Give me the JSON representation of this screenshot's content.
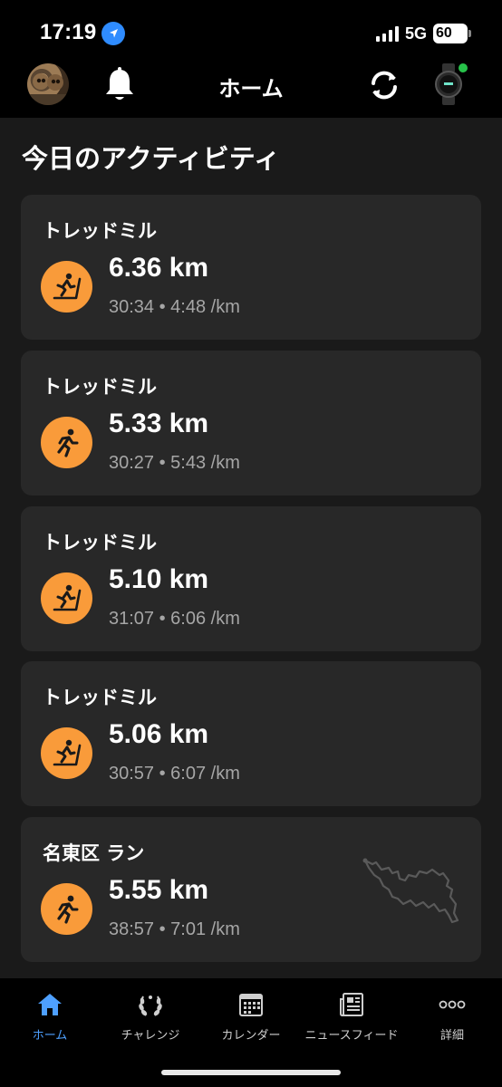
{
  "status_bar": {
    "time": "17:19",
    "network": "5G",
    "battery": "60"
  },
  "header": {
    "title": "ホーム"
  },
  "section": {
    "title": "今日のアクティビティ"
  },
  "activities": [
    {
      "title": "トレッドミル",
      "distance": "6.36 km",
      "meta": "30:34 • 4:48 /km",
      "icon": "treadmill-icon"
    },
    {
      "title": "トレッドミル",
      "distance": "5.33 km",
      "meta": "30:27 • 5:43 /km",
      "icon": "running-icon"
    },
    {
      "title": "トレッドミル",
      "distance": "5.10 km",
      "meta": "31:07 • 6:06 /km",
      "icon": "treadmill-icon"
    },
    {
      "title": "トレッドミル",
      "distance": "5.06 km",
      "meta": "30:57 • 6:07 /km",
      "icon": "treadmill-icon"
    },
    {
      "title": "名東区 ラン",
      "distance": "5.55 km",
      "meta": "38:57 • 7:01 /km",
      "icon": "running-icon"
    }
  ],
  "tabs": [
    {
      "label": "ホーム",
      "icon": "home-icon",
      "active": true
    },
    {
      "label": "チャレンジ",
      "icon": "laurel-icon"
    },
    {
      "label": "カレンダー",
      "icon": "calendar-icon"
    },
    {
      "label": "ニュースフィード",
      "icon": "newsfeed-icon"
    },
    {
      "label": "詳細",
      "icon": "more-icon"
    }
  ],
  "colors": {
    "accent": "#f99b3a",
    "active_tab": "#4ea0ff",
    "card_bg": "#282828",
    "page_bg": "#1a1a1a"
  }
}
